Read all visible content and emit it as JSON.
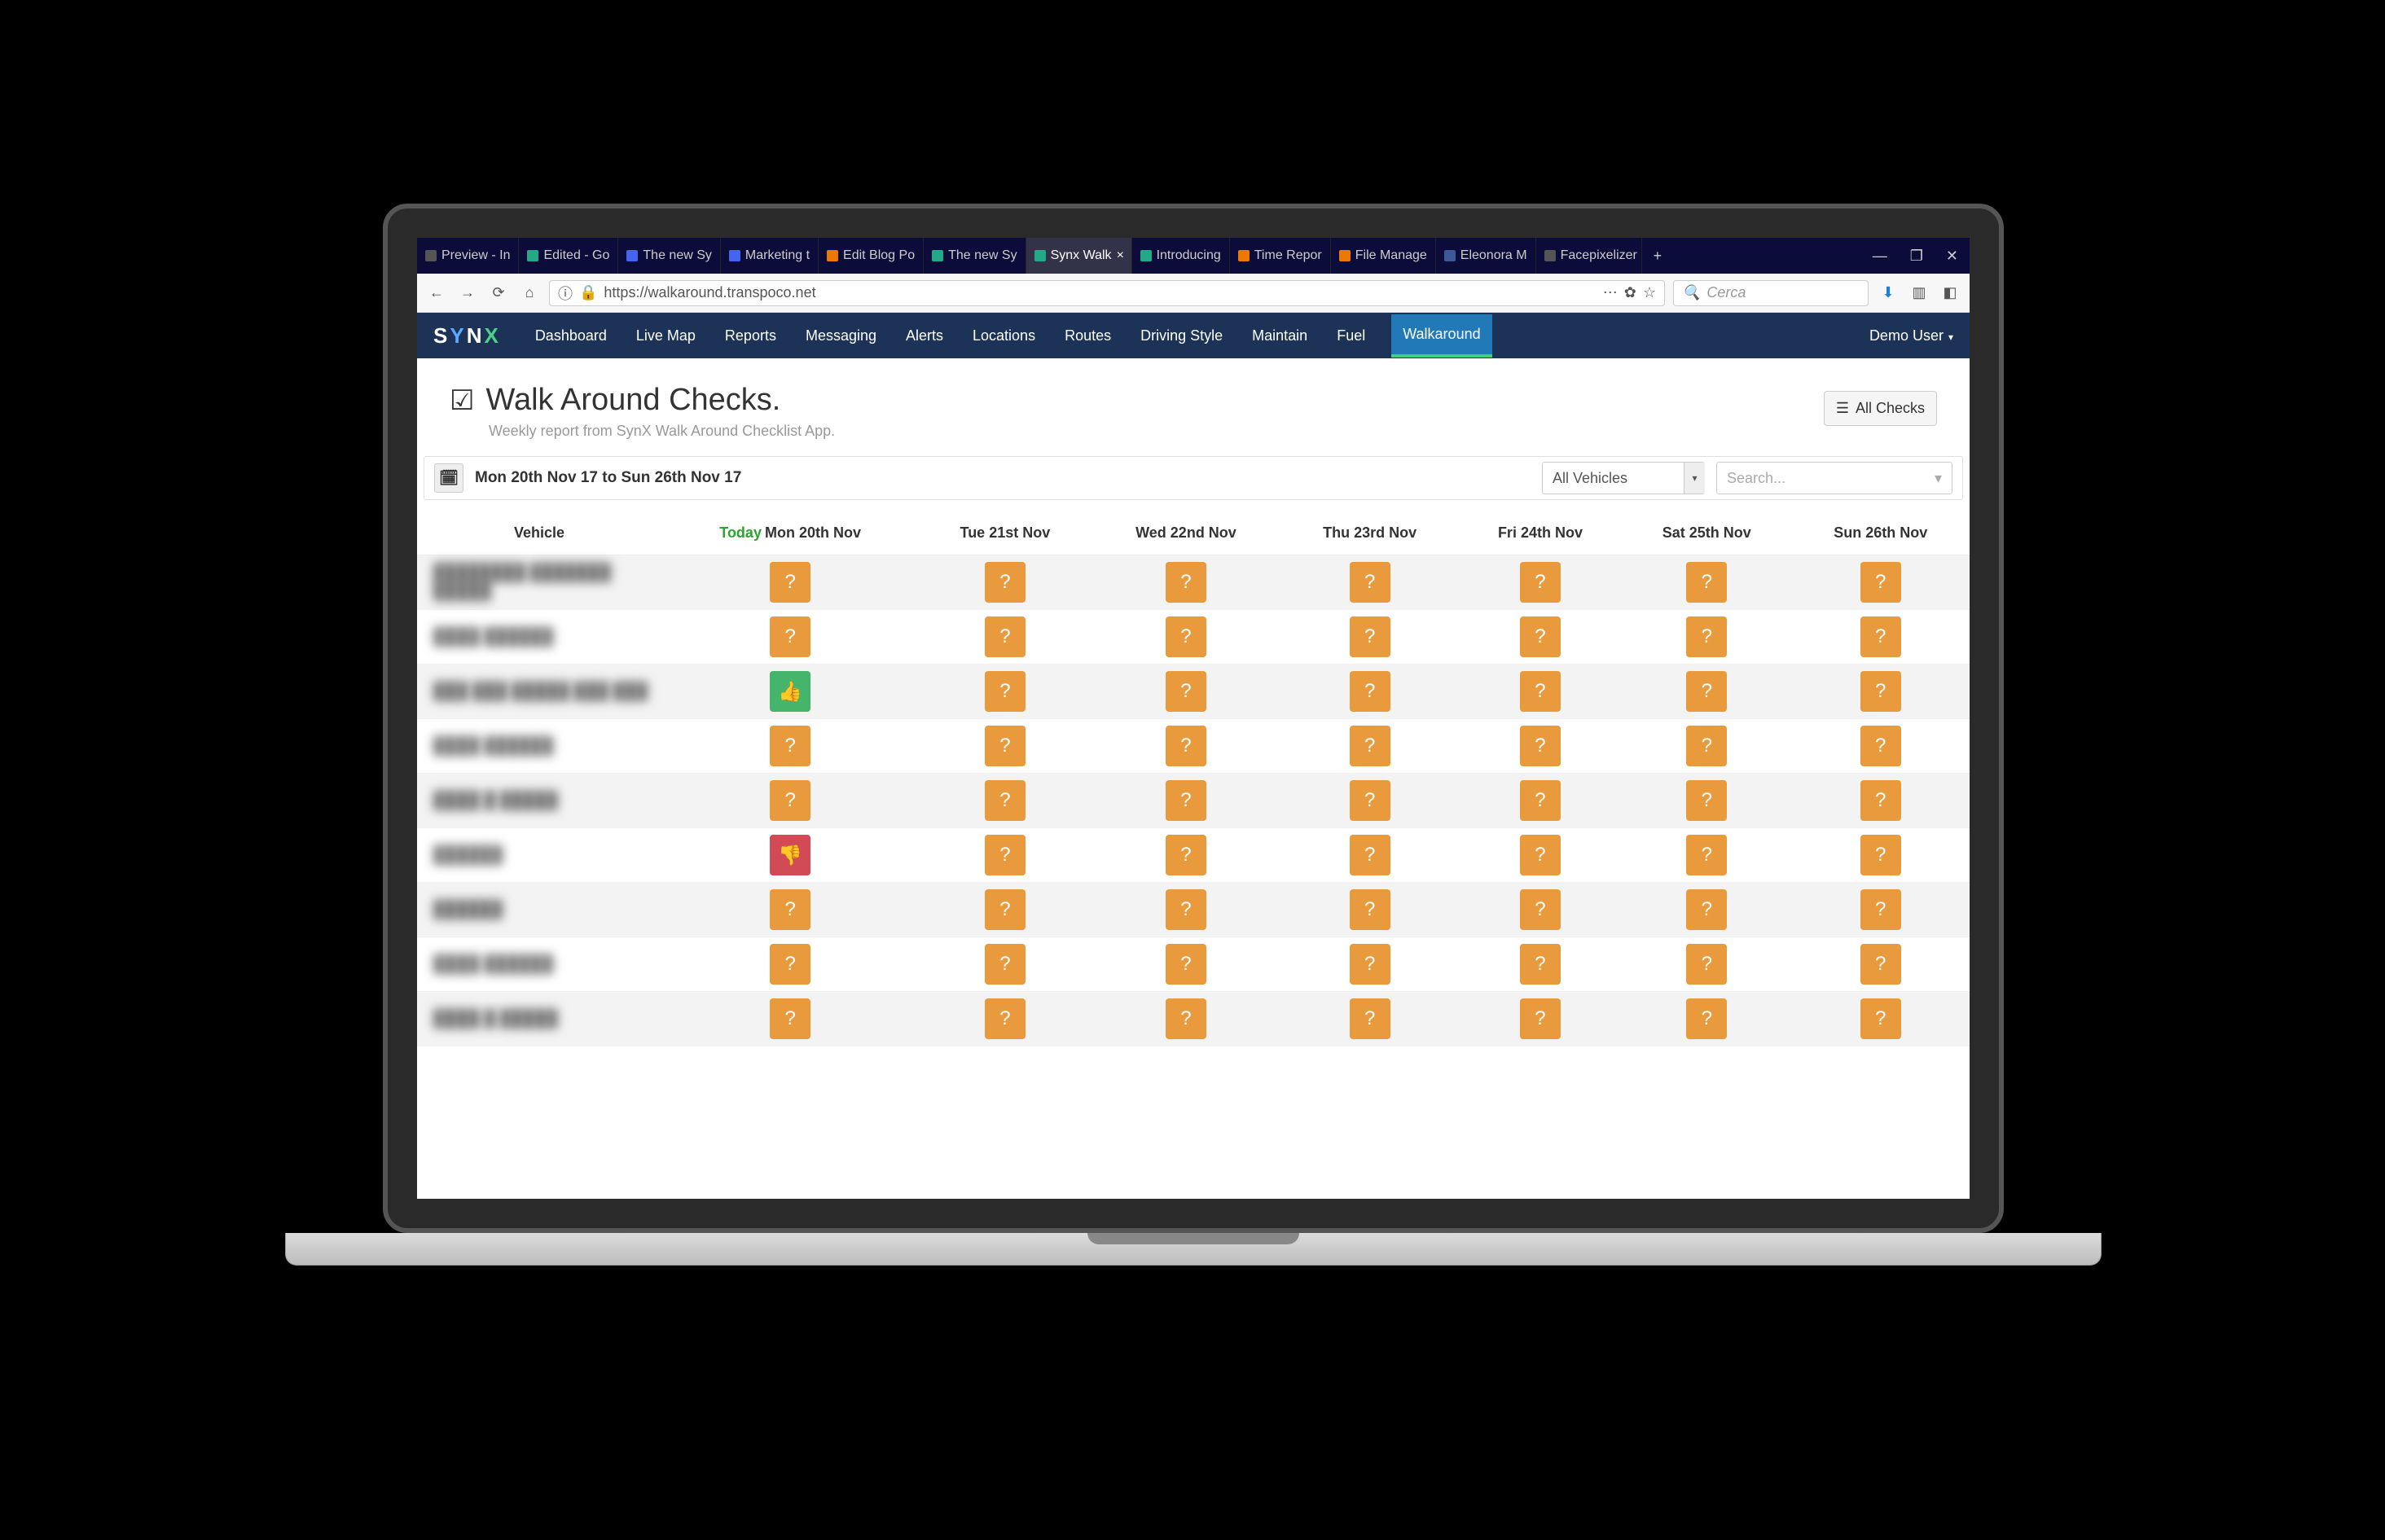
{
  "browser": {
    "tabs": [
      {
        "label": "Preview - In",
        "favicon": "#555"
      },
      {
        "label": "Edited - Go",
        "favicon": "#2a8"
      },
      {
        "label": "The new Sy",
        "favicon": "#46e"
      },
      {
        "label": "Marketing t",
        "favicon": "#46e"
      },
      {
        "label": "Edit Blog Po",
        "favicon": "#e70"
      },
      {
        "label": "The new Sy",
        "favicon": "#2a8"
      },
      {
        "label": "Synx Walk",
        "favicon": "#2a8",
        "active": true
      },
      {
        "label": "Introducing",
        "favicon": "#2a8"
      },
      {
        "label": "Time Repor",
        "favicon": "#e70"
      },
      {
        "label": "File Manage",
        "favicon": "#e70"
      },
      {
        "label": "Eleonora M",
        "favicon": "#3b5998"
      },
      {
        "label": "Facepixelizer | P",
        "favicon": "#555"
      }
    ],
    "url": "https://walkaround.transpoco.net",
    "search_placeholder": "Cerca"
  },
  "nav": {
    "brand_s": "S",
    "brand_y": "Y",
    "brand_n": "N",
    "brand_x": "X",
    "items": [
      "Dashboard",
      "Live Map",
      "Reports",
      "Messaging",
      "Alerts",
      "Locations",
      "Routes",
      "Driving Style",
      "Maintain",
      "Fuel",
      "Walkaround"
    ],
    "active": "Walkaround",
    "user": "Demo User"
  },
  "page": {
    "title": "Walk Around Checks.",
    "subtitle": "Weekly report from SynX Walk Around Checklist App.",
    "all_checks_btn": "All Checks",
    "date_range": "Mon 20th Nov 17 to Sun 26th Nov 17",
    "vehicle_filter": "All Vehicles",
    "search_placeholder": "Search..."
  },
  "table": {
    "today_label": "Today",
    "headers": [
      "Vehicle",
      "Mon 20th Nov",
      "Tue 21st Nov",
      "Wed 22nd Nov",
      "Thu 23rd Nov",
      "Fri 24th Nov",
      "Sat 25th Nov",
      "Sun 26th Nov"
    ],
    "rows": [
      {
        "name": "████████ ███████ █████",
        "cells": [
          "unknown",
          "unknown",
          "unknown",
          "unknown",
          "unknown",
          "unknown",
          "unknown"
        ]
      },
      {
        "name": "████ ██████",
        "cells": [
          "unknown",
          "unknown",
          "unknown",
          "unknown",
          "unknown",
          "unknown",
          "unknown"
        ]
      },
      {
        "name": "███ ███ █████ ███ ███",
        "cells": [
          "pass",
          "unknown",
          "unknown",
          "unknown",
          "unknown",
          "unknown",
          "unknown"
        ]
      },
      {
        "name": "████ ██████",
        "cells": [
          "unknown",
          "unknown",
          "unknown",
          "unknown",
          "unknown",
          "unknown",
          "unknown"
        ]
      },
      {
        "name": "████ █ █████",
        "cells": [
          "unknown",
          "unknown",
          "unknown",
          "unknown",
          "unknown",
          "unknown",
          "unknown"
        ]
      },
      {
        "name": "██████",
        "cells": [
          "fail",
          "unknown",
          "unknown",
          "unknown",
          "unknown",
          "unknown",
          "unknown"
        ]
      },
      {
        "name": "██████",
        "cells": [
          "unknown",
          "unknown",
          "unknown",
          "unknown",
          "unknown",
          "unknown",
          "unknown"
        ]
      },
      {
        "name": "████ ██████",
        "cells": [
          "unknown",
          "unknown",
          "unknown",
          "unknown",
          "unknown",
          "unknown",
          "unknown"
        ]
      },
      {
        "name": "████ █ █████",
        "cells": [
          "unknown",
          "unknown",
          "unknown",
          "unknown",
          "unknown",
          "unknown",
          "unknown"
        ]
      }
    ]
  }
}
